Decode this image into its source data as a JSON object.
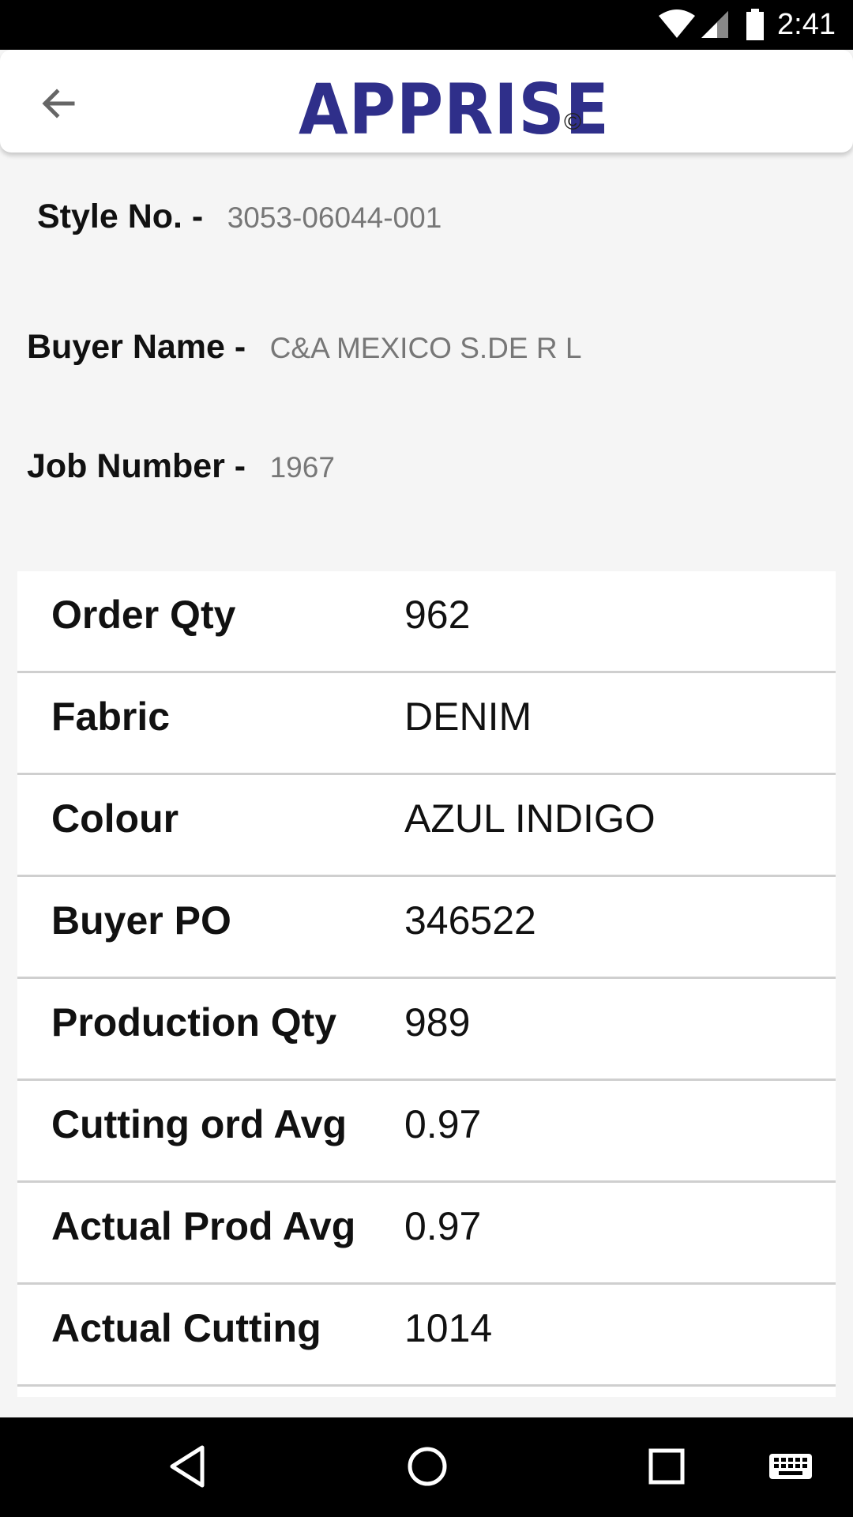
{
  "status_bar": {
    "time": "2:41",
    "icons": [
      "wifi-icon",
      "signal-icon",
      "battery-icon"
    ]
  },
  "app_bar": {
    "logo_text": "APPRISE",
    "copyright_symbol": "©",
    "back_icon": "arrow-left-icon",
    "logo_color": "#2f2f8a"
  },
  "info": {
    "style_label": "Style No. -",
    "style_value": "3053-06044-001",
    "buyer_label": "Buyer Name -",
    "buyer_value": "C&A MEXICO S.DE R L",
    "job_label": "Job Number -",
    "job_value": "1967"
  },
  "details": [
    {
      "label": "Order Qty",
      "value": "962"
    },
    {
      "label": "Fabric",
      "value": "DENIM"
    },
    {
      "label": "Colour",
      "value": "AZUL INDIGO"
    },
    {
      "label": "Buyer PO",
      "value": "346522"
    },
    {
      "label": "Production Qty",
      "value": "989"
    },
    {
      "label": "Cutting ord Avg",
      "value": "0.97"
    },
    {
      "label": "Actual Prod Avg",
      "value": "0.97"
    },
    {
      "label": "Actual Cutting",
      "value": "1014"
    }
  ],
  "nav_bar": {
    "buttons": [
      "back-triangle-icon",
      "home-circle-icon",
      "recents-square-icon",
      "keyboard-icon"
    ]
  }
}
